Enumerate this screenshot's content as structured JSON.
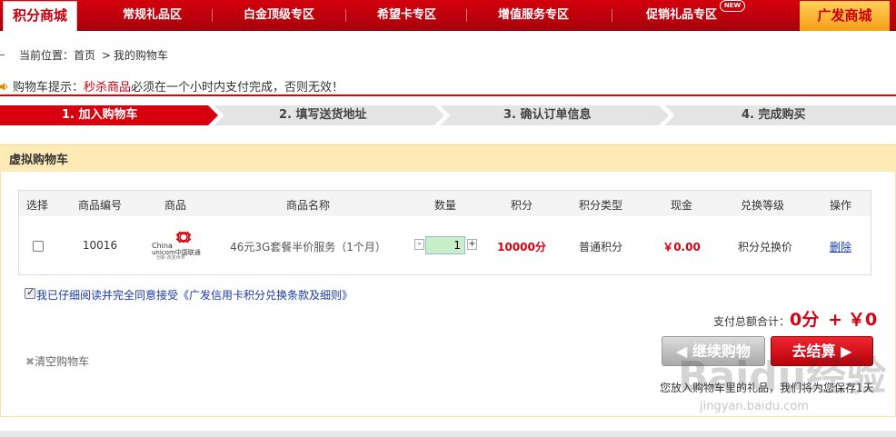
{
  "topnav": {
    "logo_left": "积分商城",
    "items": [
      "常规礼品区",
      "白金顶级专区",
      "希望卡专区",
      "增值服务专区",
      "促销礼品专区"
    ],
    "new_badge": "NEW",
    "logo_right": "广发商城"
  },
  "breadcrumb": {
    "prefix": "当前位置：",
    "home": "首页",
    "sep": ">",
    "current": "我的购物车"
  },
  "tip": {
    "prefix": "购物车提示：",
    "highlight": "秒杀商品",
    "suffix": "必须在一个小时内支付完成，否则无效！"
  },
  "steps": [
    "1. 加入购物车",
    "2. 填写送货地址",
    "3. 确认订单信息",
    "4. 完成购买"
  ],
  "panel": {
    "title": "虚拟购物车"
  },
  "table": {
    "headers": [
      "选择",
      "商品编号",
      "商品",
      "商品名称",
      "数量",
      "积分",
      "积分类型",
      "现金",
      "兑换等级",
      "操作"
    ],
    "row": {
      "code": "10016",
      "product_logo_text_1": "China",
      "product_logo_text_2": "unicom中国联通",
      "product_logo_slogan": "创新·改变世界",
      "name": "46元3G套餐半价服务（1个月）",
      "qty": "1",
      "minus": "-",
      "plus": "+",
      "points": "10000分",
      "points_type": "普通积分",
      "cash": "￥0.00",
      "level": "积分兑换价",
      "action": "删除"
    }
  },
  "agree": "我已仔细阅读并完全同意接受《广发信用卡积分兑换条款及细则》",
  "total": {
    "label": "支付总额合计：",
    "points": "0分",
    "plus": "+",
    "cash": "￥0"
  },
  "clear_cart": "清空购物车",
  "buttons": {
    "continue": "◀ 继续购物",
    "checkout": "去结算 ▶"
  },
  "note": "您放入购物车里的礼品，我们将为您保存1天",
  "watermark": {
    "text": "Baidu经验",
    "url": "jingyan.baidu.com"
  },
  "colors": {
    "brand_red": "#d6000f",
    "panel_bg": "#fdeab7",
    "link_blue": "#1a3aa8"
  }
}
